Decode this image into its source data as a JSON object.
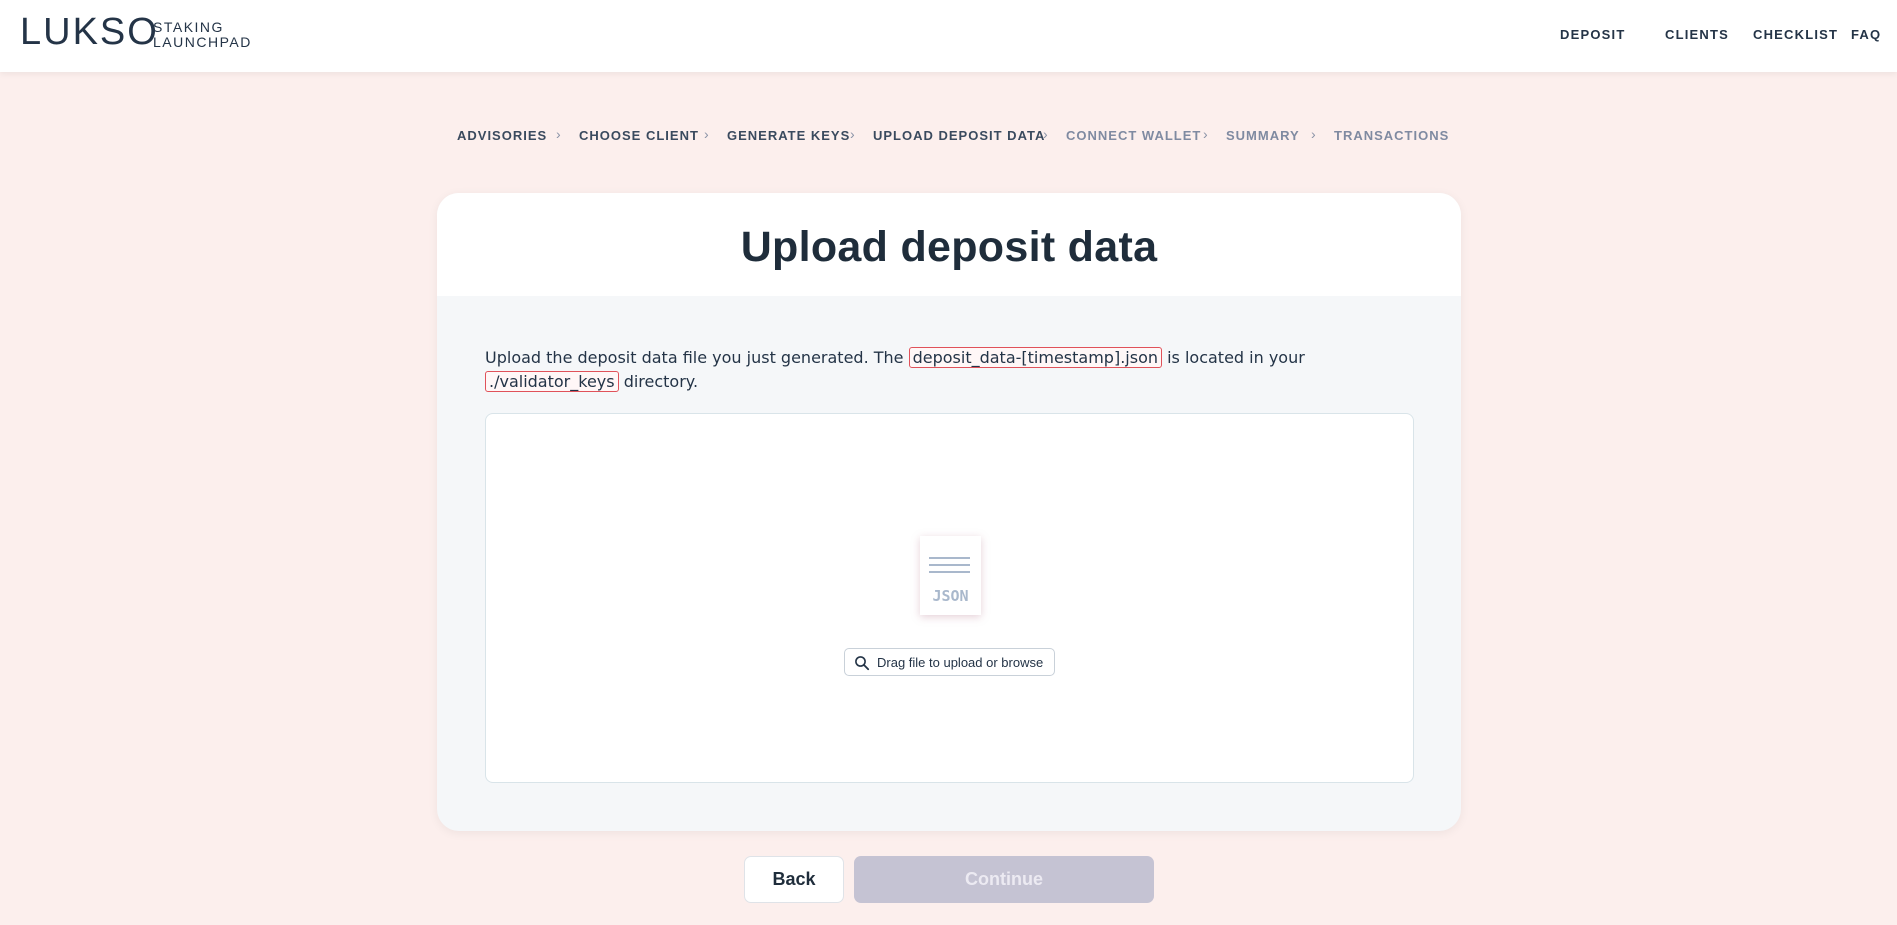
{
  "header": {
    "logo_text": "LUKSO",
    "logo_sub_line1": "STAKING",
    "logo_sub_line2": "LAUNCHPAD",
    "nav": [
      "DEPOSIT",
      "CLIENTS",
      "CHECKLIST",
      "FAQ"
    ]
  },
  "steps": {
    "items": [
      {
        "label": "ADVISORIES",
        "state": "done"
      },
      {
        "label": "CHOOSE CLIENT",
        "state": "done"
      },
      {
        "label": "GENERATE KEYS",
        "state": "done"
      },
      {
        "label": "UPLOAD DEPOSIT DATA",
        "state": "current"
      },
      {
        "label": "CONNECT WALLET",
        "state": "todo"
      },
      {
        "label": "SUMMARY",
        "state": "todo"
      },
      {
        "label": "TRANSACTIONS",
        "state": "todo"
      }
    ],
    "separator": "›"
  },
  "card": {
    "title": "Upload deposit data",
    "desc_prefix": "Upload the deposit data file you just generated. The",
    "file_name": "deposit_data-[timestamp].json",
    "desc_middle": "is located in your",
    "dir_name": "./validator_keys",
    "desc_suffix": "directory."
  },
  "dropzone": {
    "icon_label": "JSON",
    "browse_text": "Drag file to upload or browse"
  },
  "actions": {
    "back_label": "Back",
    "continue_label": "Continue"
  },
  "colors": {
    "background": "#fcefed",
    "text": "#243447",
    "code_border": "#e0525a",
    "disabled_button": "#c5c3d3"
  }
}
